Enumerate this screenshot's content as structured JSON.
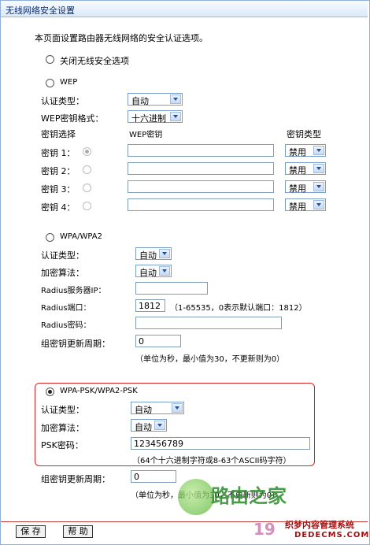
{
  "title": "无线网络安全设置",
  "intro": "本页面设置路由器无线网络的安全认证选项。",
  "disable_option": "关闭无线安全选项",
  "wep": {
    "option": "WEP",
    "auth_label": "认证类型：",
    "auth_value": "自动",
    "format_label": "WEP密钥格式：",
    "format_value": "十六进制",
    "col_select": "密钥选择",
    "col_key": "WEP密钥",
    "col_type": "密钥类型",
    "keys": [
      {
        "label": "密钥 1：",
        "type": "禁用"
      },
      {
        "label": "密钥 2：",
        "type": "禁用"
      },
      {
        "label": "密钥 3：",
        "type": "禁用"
      },
      {
        "label": "密钥 4：",
        "type": "禁用"
      }
    ]
  },
  "wpa": {
    "option": "WPA/WPA2",
    "auth_label": "认证类型：",
    "auth_value": "自动",
    "enc_label": "加密算法：",
    "enc_value": "自动",
    "radius_ip_label": "Radius服务器IP：",
    "radius_port_label": "Radius端口：",
    "radius_port_value": "1812",
    "radius_port_hint": "（1-65535，0表示默认端口：1812）",
    "radius_pwd_label": "Radius密码：",
    "group_label": "组密钥更新周期：",
    "group_value": "0",
    "group_hint": "（单位为秒，最小值为30，不更新则为0）"
  },
  "psk": {
    "option": "WPA-PSK/WPA2-PSK",
    "auth_label": "认证类型：",
    "auth_value": "自动",
    "enc_label": "加密算法：",
    "enc_value": "自动",
    "psk_label": "PSK密码：",
    "psk_value": "123456789",
    "psk_hint": "（64个十六进制字符或8-63个ASCII码字符）",
    "group_label": "组密钥更新周期：",
    "group_value": "0",
    "group_hint": "（单位为秒，最小值为30，不更新则为0）"
  },
  "buttons": {
    "save": "保 存",
    "help": "帮 助"
  },
  "watermark": {
    "brand": "路由之家",
    "num": "19",
    "cms": "织梦内容管理系统",
    "url": "DEDECMS.COM"
  }
}
